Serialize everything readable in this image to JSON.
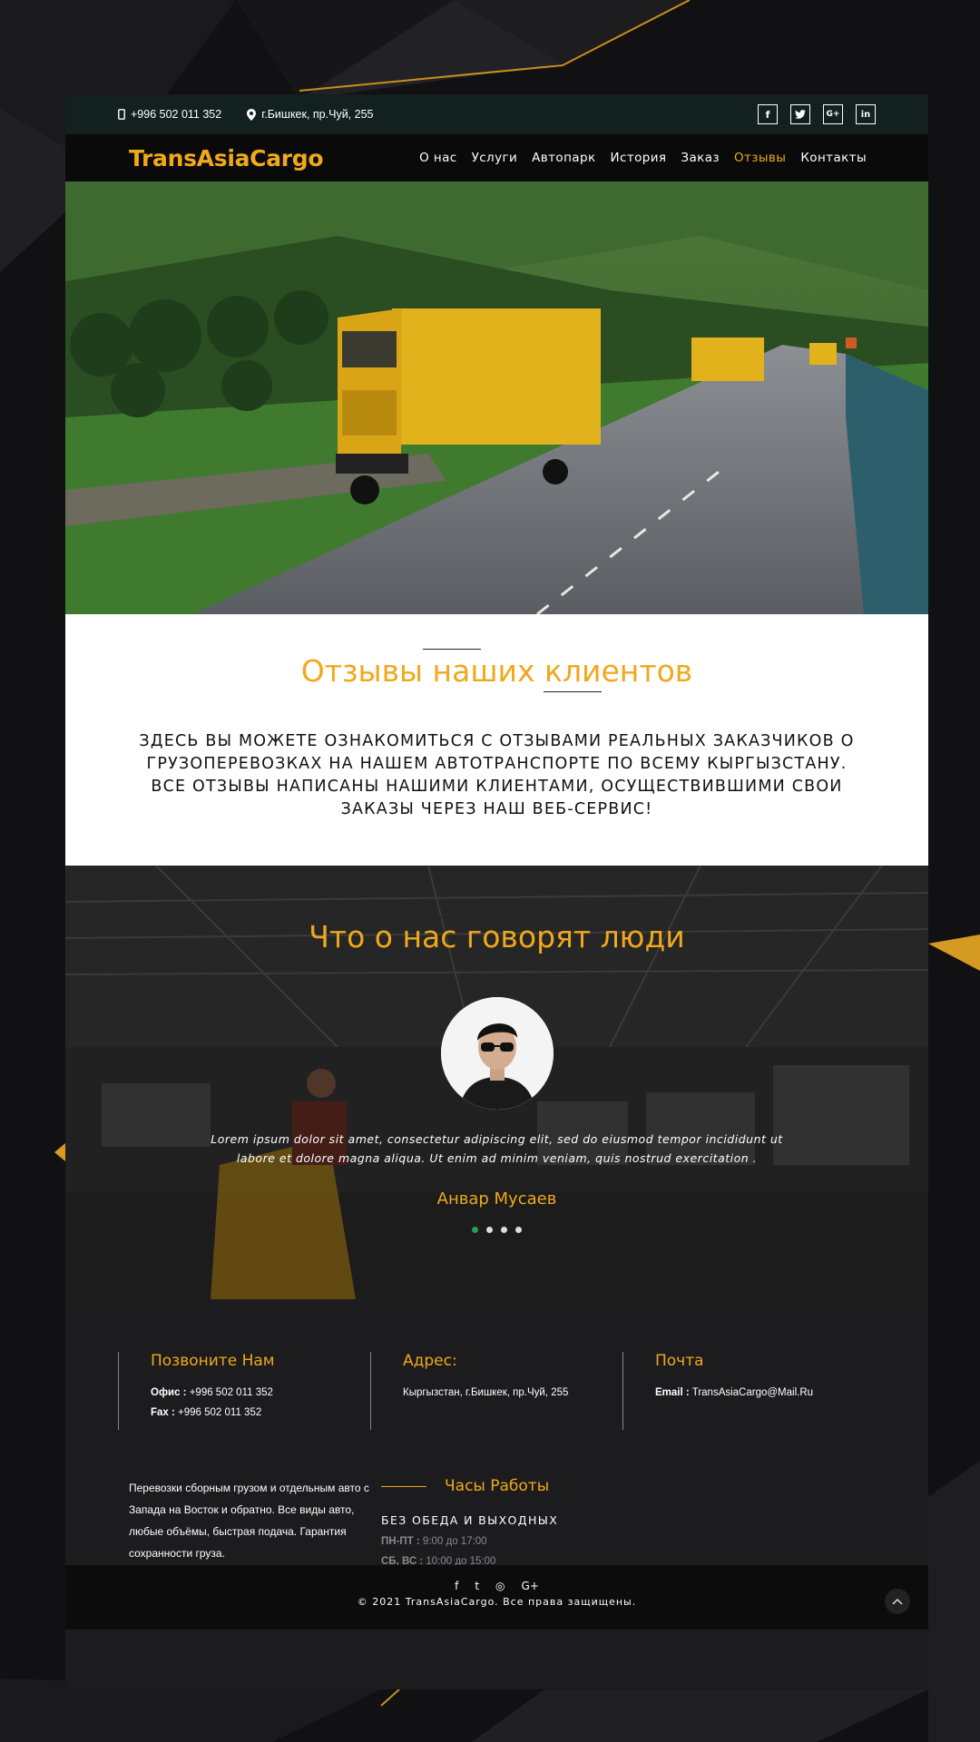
{
  "topbar": {
    "phone": "+996 502 011 352",
    "address": "г.Бишкек, пр.Чуй, 255",
    "socials": [
      {
        "icon": "facebook-icon",
        "glyph": "f"
      },
      {
        "icon": "twitter-icon",
        "glyph": "t"
      },
      {
        "icon": "google-plus-icon",
        "glyph": "G+"
      },
      {
        "icon": "linkedin-icon",
        "glyph": "in"
      }
    ]
  },
  "nav": {
    "logo": "TransAsiaCargo",
    "items": [
      "О нас",
      "Услуги",
      "Автопарк",
      "История",
      "Заказ",
      "Отзывы",
      "Контакты"
    ],
    "active": "Отзывы"
  },
  "intro": {
    "title": "Отзывы наших клиентов",
    "text": "ЗДЕСЬ ВЫ МОЖЕТЕ ОЗНАКОМИТЬСЯ С ОТЗЫВАМИ РЕАЛЬНЫХ ЗАКАЗЧИКОВ О ГРУЗОПЕРЕВОЗКАХ НА НАШЕМ АВТОТРАНСПОРТЕ ПО ВСЕМУ КЫРГЫЗСТАНУ. ВСЕ ОТЗЫВЫ НАПИСАНЫ НАШИМИ КЛИЕНТАМИ, ОСУЩЕСТВИВШИМИ СВОИ ЗАКАЗЫ ЧЕРЕЗ НАШ ВЕБ-СЕРВИС!"
  },
  "testimonial": {
    "title": "Что о нас говорят люди",
    "quote": "Lorem ipsum dolor sit amet, consectetur adipiscing elit, sed do eiusmod tempor incididunt ut labore et dolore magna aliqua. Ut enim ad minim veniam, quis nostrud exercitation .",
    "name": "Анвар Мусаев",
    "slides": 4,
    "active_slide": 1
  },
  "footer": {
    "call": {
      "title": "Позвоните Нам",
      "office_label": "Офис :",
      "office": "+996 502 011 352",
      "fax_label": "Fax :",
      "fax": "+996 502 011 352"
    },
    "address": {
      "title": "Адрес:",
      "text": "Кыргызстан, г.Бишкек, пр.Чуй, 255"
    },
    "mail": {
      "title": "Почта",
      "label": "Email :",
      "email": "TransAsiaCargo@Mail.Ru"
    },
    "about": "Перевозки сборным грузом и отдельным авто с Запада на Восток и обратно. Все виды авто, любые объёмы, быстрая подача. Гарантия сохранности груза.",
    "hours": {
      "title": "Часы Работы",
      "subtitle": "БЕЗ ОБЕДА И ВЫХОДНЫХ",
      "rows": [
        {
          "days": "ПН-ПТ :",
          "time": "9:00 до 17:00"
        },
        {
          "days": "СБ, ВС :",
          "time": "10:00 до 15:00"
        }
      ]
    },
    "copyright": "© 2021 TransAsiaCargo. Все права защищены.",
    "bottom_icons": [
      "f",
      "t",
      "◎",
      "G+"
    ]
  },
  "colors": {
    "accent": "#f0a81c",
    "dark": "#1c1c1e",
    "dot_active": "#22a05a"
  }
}
